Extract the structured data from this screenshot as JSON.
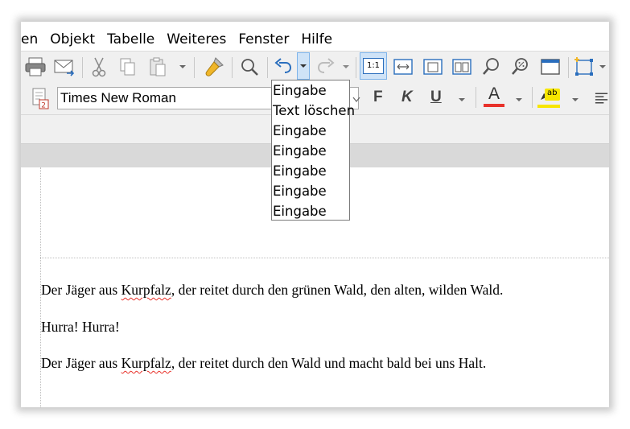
{
  "menu": [
    "en",
    "Objekt",
    "Tabelle",
    "Weiteres",
    "Fenster",
    "Hilfe"
  ],
  "toolbar2": {
    "font_name": "Times New Roman",
    "bold_label": "F",
    "italic_label": "K",
    "underline_label": "U",
    "font_color_label": "A",
    "highlight_label": "ab",
    "font_color": "#e8322b",
    "highlight_color": "#f7e600"
  },
  "zoom_badge": "1:1",
  "undo_dropdown": {
    "items": [
      "Eingabe",
      "Text löschen",
      "Eingabe",
      "Eingabe",
      "Eingabe",
      "Eingabe",
      "Eingabe"
    ]
  },
  "document": {
    "p1_pre": "Der Jäger aus ",
    "p1_word": "Kurpfalz",
    "p1_post": ", der reitet durch den grünen Wald, den alten, wilden Wald.",
    "p2": "Hurra! Hurra!",
    "p3_pre": "Der Jäger aus ",
    "p3_word": "Kurpfalz",
    "p3_post": ", der reitet durch den Wald und macht bald bei uns Halt."
  },
  "colors": {
    "accent": "#2a6ebd",
    "spell_error": "#e8322b"
  }
}
